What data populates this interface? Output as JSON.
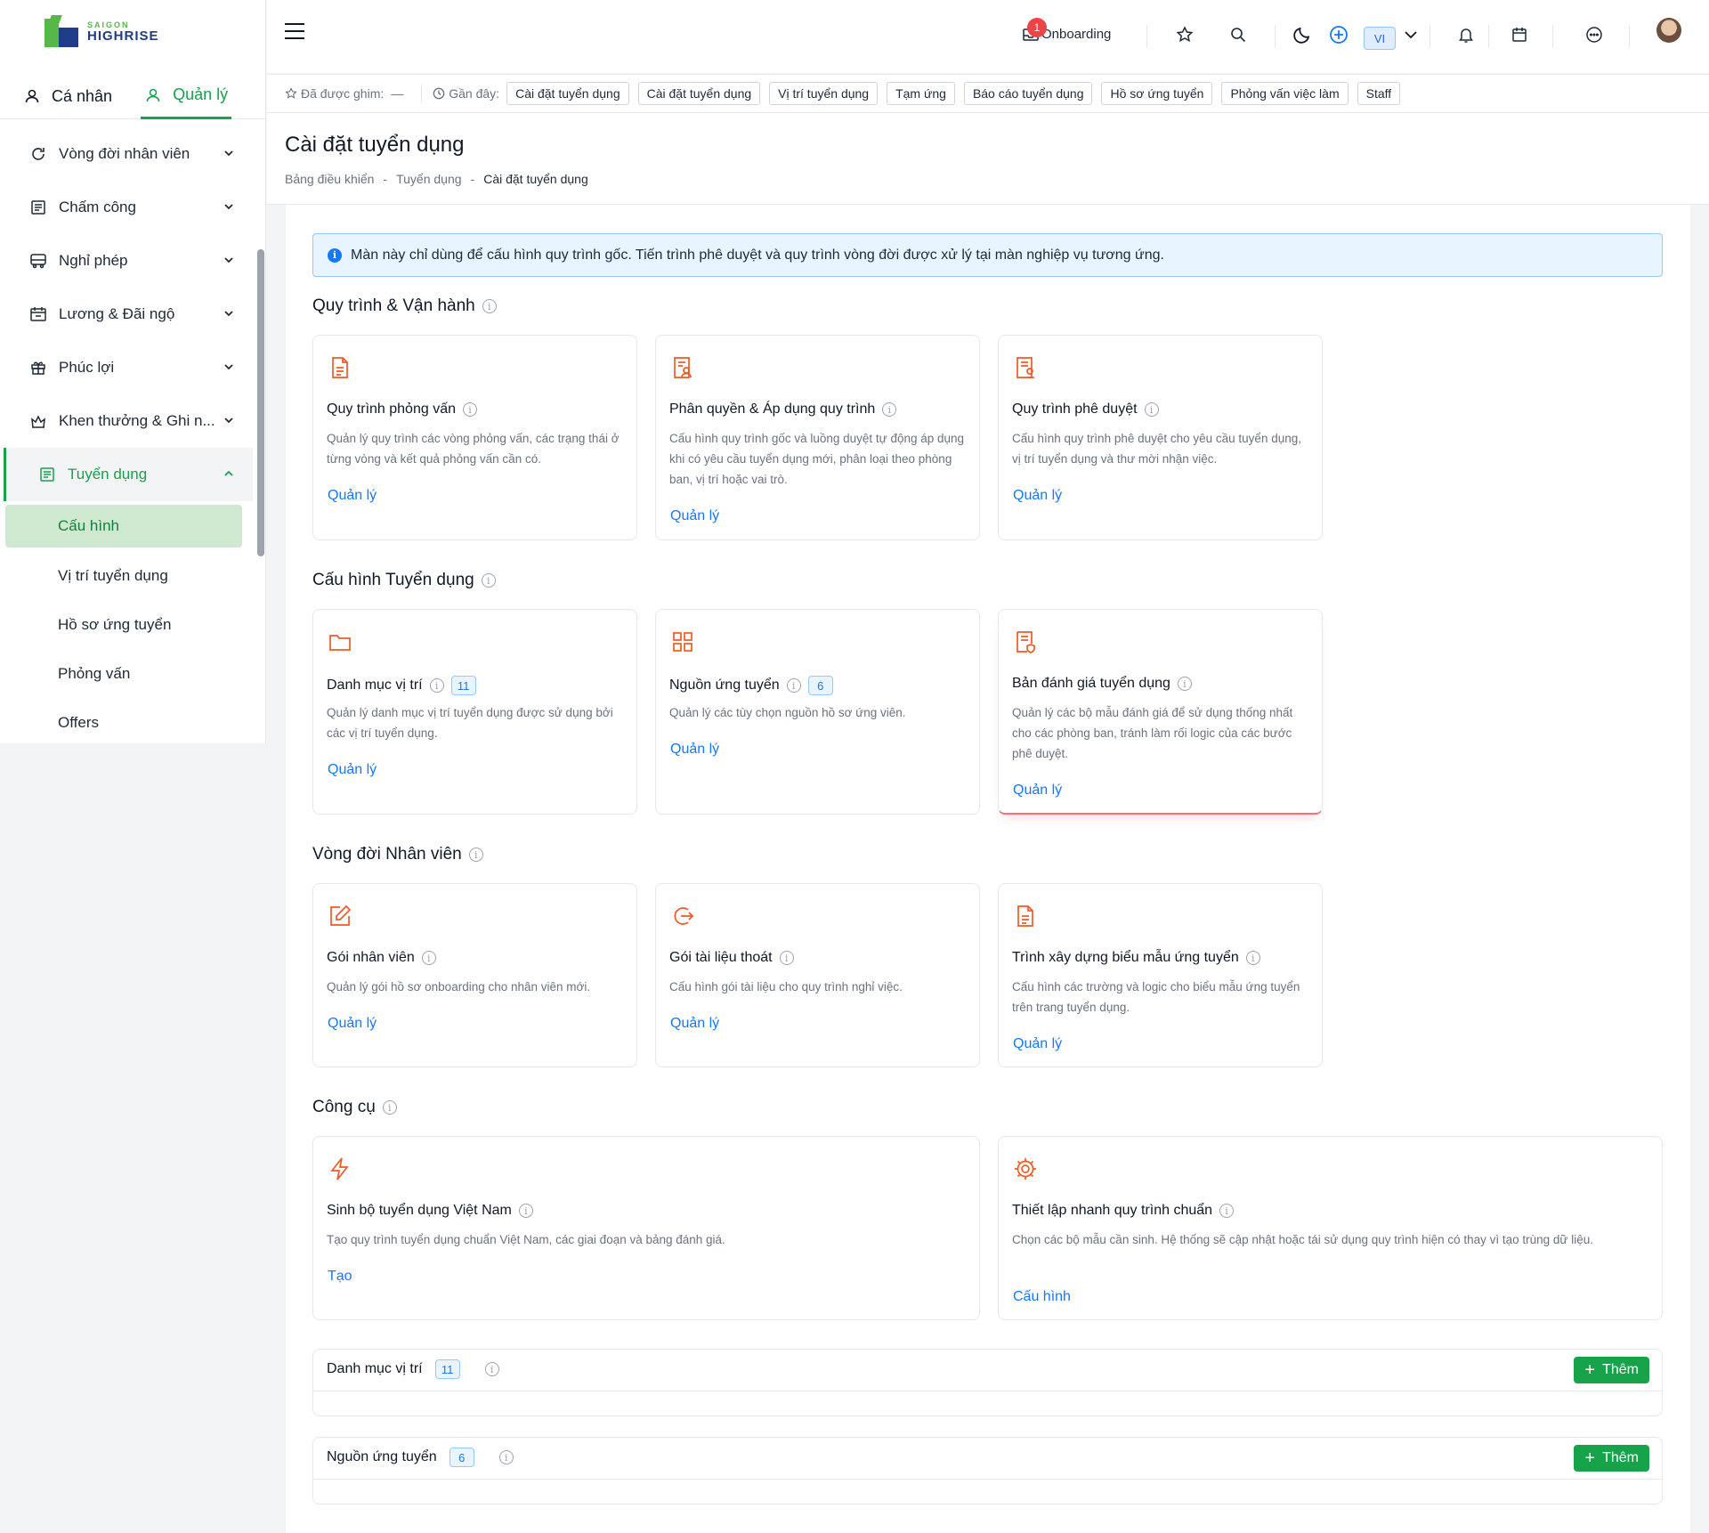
{
  "app": {
    "logo_line1": "SAIGON",
    "logo_line2": "HIGHRISE",
    "brand_color": "#16a34a",
    "accent_color": "#1677ff",
    "icon_color": "#f15a24"
  },
  "sidebar": {
    "tabs": [
      {
        "label": "Cá nhân"
      },
      {
        "label": "Quản lý"
      }
    ],
    "menu": [
      {
        "label": "Vòng đời nhân viên",
        "icon": "refresh-icon"
      },
      {
        "label": "Chấm công",
        "icon": "calendar-grid-icon"
      },
      {
        "label": "Nghỉ phép",
        "icon": "bus-icon"
      },
      {
        "label": "Lương & Đãi ngộ",
        "icon": "calendar-money-icon"
      },
      {
        "label": "Phúc lợi",
        "icon": "gift-icon"
      },
      {
        "label": "Khen thưởng & Ghi n...",
        "icon": "award-icon"
      },
      {
        "label": "Tuyển dụng",
        "icon": "doc-list-icon"
      }
    ],
    "submenu": [
      {
        "label": "Cấu hình"
      },
      {
        "label": "Vị trí tuyển dụng"
      },
      {
        "label": "Hồ sơ ứng tuyển"
      },
      {
        "label": "Phỏng vấn"
      },
      {
        "label": "Offers"
      }
    ]
  },
  "topbar": {
    "onboarding_label": "Onboarding",
    "onboarding_badge": "1",
    "language": "VI"
  },
  "pinbar": {
    "pinned_label": "Đã được ghim:",
    "pinned_empty": "—",
    "recent_label": "Gần đây:",
    "recent": [
      "Cài đặt tuyển dụng",
      "Cài đặt tuyển dụng",
      "Vị trí tuyển dụng",
      "Tạm ứng",
      "Báo cáo tuyển dụng",
      "Hồ sơ ứng tuyển",
      "Phỏng vấn việc làm",
      "Staff"
    ]
  },
  "page": {
    "title": "Cài đặt tuyển dụng",
    "breadcrumb": [
      "Bảng điều khiển",
      "Tuyển dụng",
      "Cài đặt tuyển dụng"
    ],
    "breadcrumb_sep": "-",
    "alert": "Màn này chỉ dùng để cấu hình quy trình gốc. Tiến trình phê duyệt và quy trình vòng đời được xử lý tại màn nghiệp vụ tương ứng."
  },
  "sections": [
    {
      "title": "Quy trình & Vận hành",
      "cards": [
        {
          "title": "Quy trình phỏng vấn",
          "desc": "Quản lý quy trình các vòng phỏng vấn, các trạng thái ở từng vòng và kết quả phỏng vấn cần có.",
          "link": "Quản lý",
          "icon": "document-icon"
        },
        {
          "title": "Phân quyền & Áp dụng quy trình",
          "desc": "Cấu hình quy trình gốc và luồng duyệt tự động áp dụng khi có yêu cầu tuyển dụng mới, phân loại theo phòng ban, vị trí hoặc vai trò.",
          "link": "Quản lý",
          "icon": "doc-user-icon"
        },
        {
          "title": "Quy trình phê duyệt",
          "desc": "Cấu hình quy trình phê duyệt cho yêu cầu tuyển dụng, vị trí tuyển dụng và thư mời nhận việc.",
          "link": "Quản lý",
          "icon": "doc-approve-icon"
        }
      ]
    },
    {
      "title": "Cấu hình Tuyển dụng",
      "cards": [
        {
          "title": "Danh mục vị trí",
          "count": "11",
          "desc": "Quản lý danh mục vị trí tuyển dụng được sử dụng bởi các vị trí tuyển dụng.",
          "link": "Quản lý",
          "icon": "folder-icon"
        },
        {
          "title": "Nguồn ứng tuyển",
          "count": "6",
          "desc": "Quản lý các tùy chọn nguồn hồ sơ ứng viên.",
          "link": "Quản lý",
          "icon": "grid-icon"
        },
        {
          "title": "Bản đánh giá tuyển dụng",
          "desc": "Quản lý các bộ mẫu đánh giá để sử dụng thống nhất cho các phòng ban, tránh làm rối logic của các bước phê duyệt.",
          "link": "Quản lý",
          "icon": "doc-shield-icon"
        }
      ]
    },
    {
      "title": "Vòng đời Nhân viên",
      "cards": [
        {
          "title": "Gói nhân viên",
          "desc": "Quản lý gói hồ sơ onboarding cho nhân viên mới.",
          "link": "Quản lý",
          "icon": "edit-icon"
        },
        {
          "title": "Gói tài liệu thoát",
          "desc": "Cấu hình gói tài liệu cho quy trình nghỉ việc.",
          "link": "Quản lý",
          "icon": "exit-icon"
        },
        {
          "title": "Trình xây dựng biểu mẫu ứng tuyển",
          "desc": "Cấu hình các trường và logic cho biểu mẫu ứng tuyển trên trang tuyển dụng.",
          "link": "Quản lý",
          "icon": "form-icon"
        }
      ]
    },
    {
      "title": "Công cụ",
      "cards": [
        {
          "title": "Sinh bộ tuyển dụng Việt Nam",
          "desc": "Tạo quy trình tuyển dụng chuẩn Việt Nam, các giai đoạn và bảng đánh giá.",
          "link": "Tạo",
          "icon": "lightning-icon"
        },
        {
          "title": "Thiết lập nhanh quy trình chuẩn",
          "desc": "Chọn các bộ mẫu cần sinh. Hệ thống sẽ cập nhật hoặc tái sử dụng quy trình hiện có thay vì tạo trùng dữ liệu.",
          "link": "Cấu hình",
          "icon": "gear-icon"
        }
      ]
    }
  ],
  "panels": [
    {
      "title": "Danh mục vị trí",
      "count": "11",
      "button": "Thêm"
    },
    {
      "title": "Nguồn ứng tuyển",
      "count": "6",
      "button": "Thêm"
    }
  ]
}
